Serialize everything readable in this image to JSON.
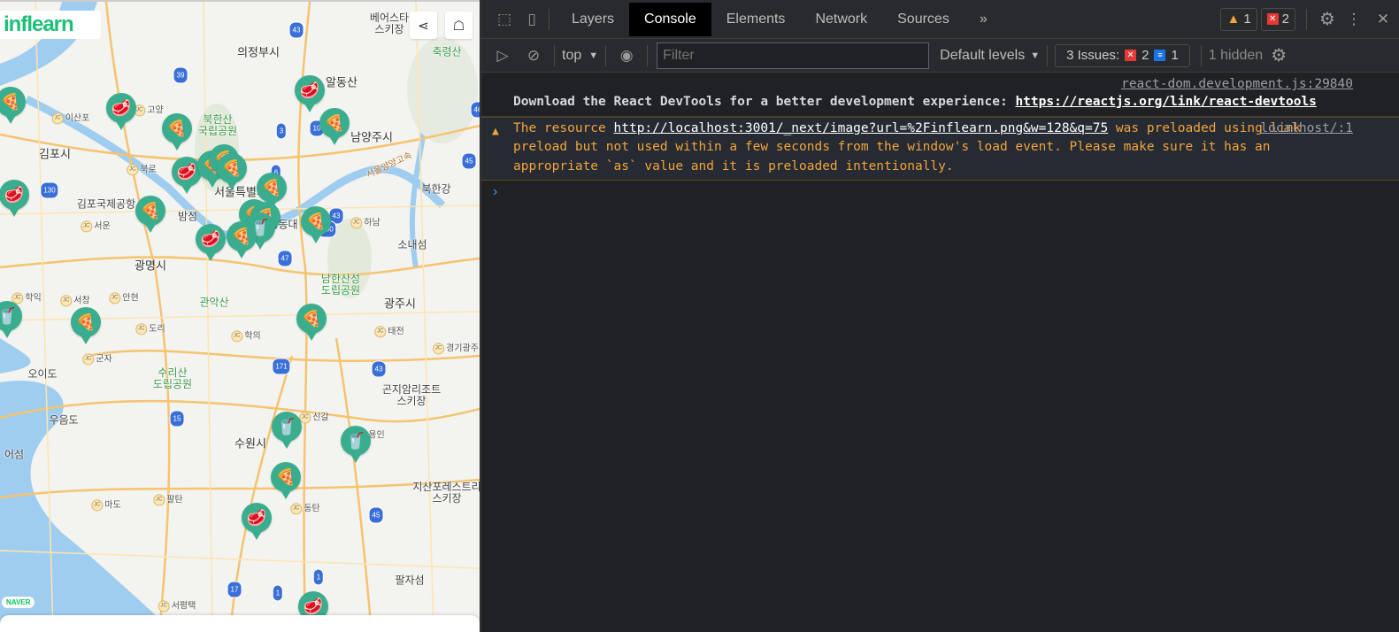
{
  "map": {
    "logo": "inflearn",
    "share_icon": "share-icon",
    "feedback_icon": "feedback-icon",
    "attribution": "NAVER",
    "labels": [
      {
        "text": "의정부시",
        "kind": "city"
      },
      {
        "text": "알동산",
        "kind": "city"
      },
      {
        "text": "남양주시",
        "kind": "city"
      },
      {
        "text": "김포시",
        "kind": "city"
      },
      {
        "text": "서울특별시",
        "kind": "city"
      },
      {
        "text": "김포국제공항",
        "kind": "poi"
      },
      {
        "text": "밤섬",
        "kind": "poi"
      },
      {
        "text": "광명시",
        "kind": "city"
      },
      {
        "text": "관악산",
        "kind": "park"
      },
      {
        "text": "남한산성\n도립공원",
        "kind": "park"
      },
      {
        "text": "광주시",
        "kind": "city"
      },
      {
        "text": "수리산\n도립공원",
        "kind": "park"
      },
      {
        "text": "오이도",
        "kind": "poi"
      },
      {
        "text": "우음도",
        "kind": "poi"
      },
      {
        "text": "수원시",
        "kind": "city"
      },
      {
        "text": "어섬",
        "kind": "poi"
      },
      {
        "text": "곤지암리조트\n스키장",
        "kind": "poi"
      },
      {
        "text": "지산포레스트리\n스키장",
        "kind": "poi"
      },
      {
        "text": "팔자섬",
        "kind": "poi"
      },
      {
        "text": "소내섬",
        "kind": "poi"
      },
      {
        "text": "북한강",
        "kind": "poi"
      },
      {
        "text": "축령산",
        "kind": "park"
      },
      {
        "text": "베어스타\n스키장",
        "kind": "poi"
      },
      {
        "text": "북한산\n국립공원",
        "kind": "park"
      },
      {
        "text": "서울양양고속",
        "kind": "road"
      },
      {
        "text": "영동대",
        "kind": "poi"
      }
    ],
    "junctions": [
      "이산포",
      "고양",
      "북로",
      "서운",
      "학익",
      "서창",
      "안현",
      "도리",
      "학의",
      "군자",
      "신갈",
      "용인",
      "마도",
      "팔탄",
      "동탄",
      "서평택",
      "태전",
      "경기광주",
      "하남"
    ],
    "road_shields": [
      "39",
      "43",
      "3",
      "6",
      "10",
      "46",
      "45",
      "130",
      "43",
      "47",
      "100",
      "171",
      "43",
      "15",
      "45",
      "17",
      "1",
      "1"
    ],
    "markers": [
      "pizza",
      "meat",
      "pizza",
      "meat",
      "pizza",
      "meat",
      "pizza",
      "pizza",
      "pizza",
      "pizza",
      "pizza",
      "pizza",
      "cup",
      "pizza",
      "meat",
      "pizza",
      "pizza",
      "meat",
      "cup",
      "pizza",
      "pizza",
      "cup",
      "cup",
      "pizza",
      "meat",
      "meat"
    ],
    "marker_color": "#3aad8f"
  },
  "devtools": {
    "tabs": [
      "Layers",
      "Console",
      "Elements",
      "Network",
      "Sources"
    ],
    "active_tab": "Console",
    "more_tabs": "»",
    "warnings_count": "1",
    "errors_count": "2",
    "context": "top",
    "filter_placeholder": "Filter",
    "levels": "Default levels",
    "issues_label": "3 Issues:",
    "issues_errors": "2",
    "issues_info": "1",
    "hidden": "1 hidden",
    "messages": [
      {
        "level": "info",
        "source": "react-dom.development.js:29840",
        "text": "Download the React DevTools for a better development experience: ",
        "link": "https://reactjs.org/link/react-devtools"
      },
      {
        "level": "warning",
        "source": "localhost/:1",
        "text_before": "The resource ",
        "link": "http://localhost:3001/_next/image?url=%2Finflearn.png&w=128&q=75",
        "text_after": " was preloaded using link preload but not used within a few seconds from the window's load event. Please make sure it has an appropriate `as` value and it is preloaded intentionally."
      }
    ],
    "warning_color": "#f2a43a",
    "error_color": "#e53935"
  }
}
